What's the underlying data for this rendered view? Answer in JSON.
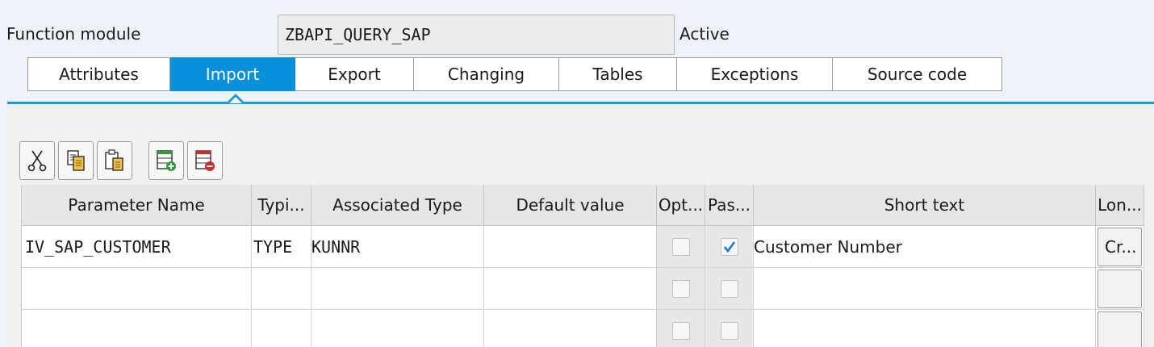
{
  "header": {
    "label": "Function module",
    "name": "ZBAPI_QUERY_SAP",
    "status": "Active"
  },
  "tabs": [
    {
      "label": "Attributes",
      "active": false
    },
    {
      "label": "Import",
      "active": true
    },
    {
      "label": "Export",
      "active": false
    },
    {
      "label": "Changing",
      "active": false
    },
    {
      "label": "Tables",
      "active": false
    },
    {
      "label": "Exceptions",
      "active": false
    },
    {
      "label": "Source code",
      "active": false
    }
  ],
  "toolbar": {
    "icons": [
      "cut-icon",
      "copy-icon",
      "paste-icon",
      "insert-row-icon",
      "delete-row-icon"
    ]
  },
  "table": {
    "columns": [
      "Parameter Name",
      "Typi...",
      "Associated Type",
      "Default value",
      "Opt...",
      "Pas...",
      "Short text",
      "Lon..."
    ],
    "rows": [
      {
        "param": "IV_SAP_CUSTOMER",
        "typing": "TYPE",
        "assoc": "KUNNR",
        "default": "",
        "optional": false,
        "pass_value": true,
        "short_text": "Customer Number",
        "long_text": "Cr..."
      },
      {
        "param": "",
        "typing": "",
        "assoc": "",
        "default": "",
        "optional": false,
        "pass_value": false,
        "short_text": "",
        "long_text": ""
      },
      {
        "param": "",
        "typing": "",
        "assoc": "",
        "default": "",
        "optional": false,
        "pass_value": false,
        "short_text": "",
        "long_text": ""
      }
    ]
  },
  "colors": {
    "accent": "#0a90da",
    "panel_line": "#1c9ad6",
    "background": "#edf3f9",
    "check": "#1a7fc4"
  }
}
